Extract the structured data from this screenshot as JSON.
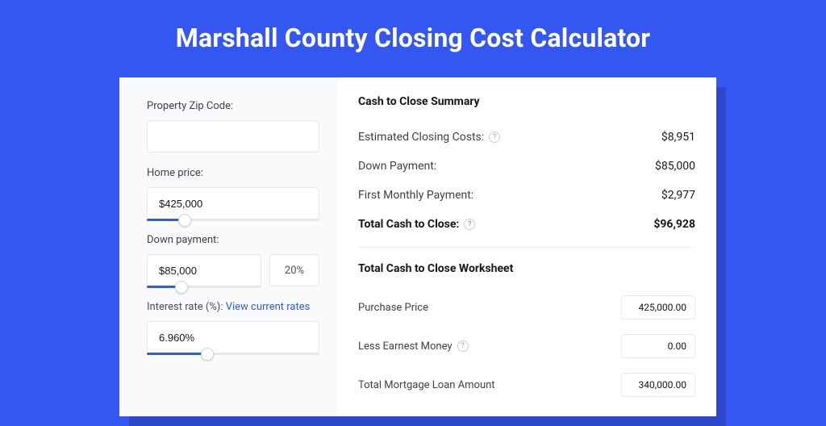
{
  "title": "Marshall County Closing Cost Calculator",
  "form": {
    "zip_label": "Property Zip Code:",
    "zip_value": "",
    "home_price_label": "Home price:",
    "home_price_value": "$425,000",
    "down_payment_label": "Down payment:",
    "down_payment_value": "$85,000",
    "down_payment_pct": "20%",
    "interest_label": "Interest rate (%):",
    "interest_link": "View current rates",
    "interest_value": "6.960%"
  },
  "summary": {
    "title": "Cash to Close Summary",
    "rows": [
      {
        "label": "Estimated Closing Costs:",
        "help": true,
        "value": "$8,951"
      },
      {
        "label": "Down Payment:",
        "help": false,
        "value": "$85,000"
      },
      {
        "label": "First Monthly Payment:",
        "help": false,
        "value": "$2,977"
      }
    ],
    "total_label": "Total Cash to Close:",
    "total_value": "$96,928"
  },
  "worksheet": {
    "title": "Total Cash to Close Worksheet",
    "rows": [
      {
        "label": "Purchase Price",
        "help": false,
        "value": "425,000.00"
      },
      {
        "label": "Less Earnest Money",
        "help": true,
        "value": "0.00"
      },
      {
        "label": "Total Mortgage Loan Amount",
        "help": false,
        "value": "340,000.00"
      }
    ]
  }
}
